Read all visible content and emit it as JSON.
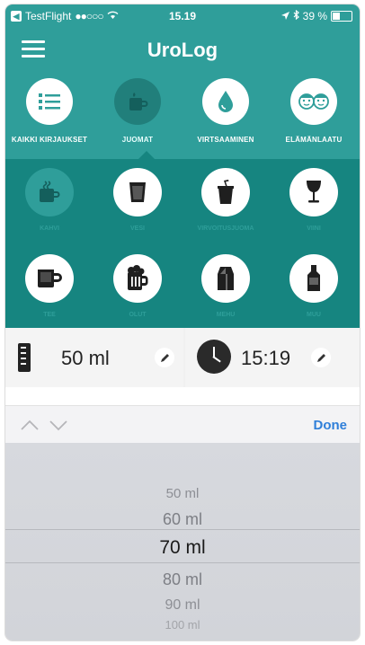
{
  "status": {
    "carrier": "TestFlight",
    "signal": "●●○○○",
    "time": "15.19",
    "battery": "39 %"
  },
  "header": {
    "title": "UroLog"
  },
  "categories": [
    {
      "label": "KAIKKI KIRJAUKSET",
      "icon": "list-icon"
    },
    {
      "label": "JUOMAT",
      "icon": "cup-icon"
    },
    {
      "label": "VIRTSAAMINEN",
      "icon": "drop-icon"
    },
    {
      "label": "ELÄMÄNLAATU",
      "icon": "faces-icon"
    }
  ],
  "drinks": [
    {
      "label": "KAHVI",
      "icon": "coffee-icon"
    },
    {
      "label": "VESI",
      "icon": "water-glass-icon"
    },
    {
      "label": "VIRVOITUSJUOMA",
      "icon": "soda-icon"
    },
    {
      "label": "VIINI",
      "icon": "wine-icon"
    },
    {
      "label": "TEE",
      "icon": "tea-icon"
    },
    {
      "label": "OLUT",
      "icon": "beer-icon"
    },
    {
      "label": "MEHU",
      "icon": "juice-icon"
    },
    {
      "label": "MUU",
      "icon": "bottle-icon"
    }
  ],
  "entry": {
    "volume": "50 ml",
    "time": "15:19"
  },
  "toolbar": {
    "done_label": "Done"
  },
  "picker": {
    "options": [
      "50 ml",
      "60 ml",
      "70 ml",
      "80 ml",
      "90 ml",
      "100 ml"
    ],
    "selected": "70 ml"
  },
  "colors": {
    "primary": "#2f9e9a",
    "dark": "#168580",
    "link": "#2f7fd9"
  }
}
